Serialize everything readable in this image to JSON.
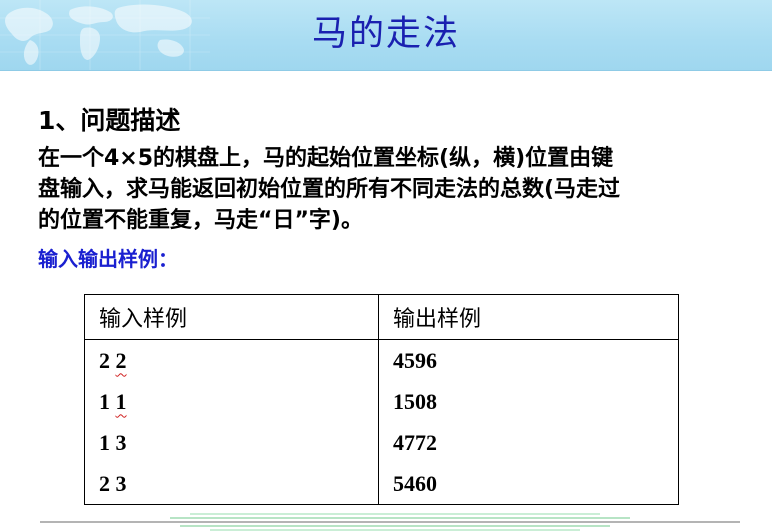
{
  "slide": {
    "title": "马的走法",
    "section_heading": "1、问题描述",
    "description_lines": [
      "在一个4×5的棋盘上，马的起始位置坐标(纵，横)位置由键",
      "盘输入，求马能返回初始位置的所有不同走法的总数(马走过",
      "的位置不能重复，马走“日”字)。"
    ],
    "sample_heading": "输入输出样例："
  },
  "table": {
    "headers": [
      "输入样例",
      "输出样例"
    ],
    "rows": [
      {
        "input_a": "2",
        "input_b": "2",
        "output": "4596"
      },
      {
        "input_a": "1",
        "input_b": "1",
        "output": "1508"
      },
      {
        "input_a": "1",
        "input_b": "3",
        "output": "4772"
      },
      {
        "input_a": "2",
        "input_b": "3",
        "output": "5460"
      }
    ]
  },
  "colors": {
    "title": "#1a20b0",
    "sample_heading": "#1a20d0",
    "header_band": "#a8dcf2",
    "spellcheck_underline": "#d02020"
  },
  "icons": {
    "header_decoration": "world-map-graphic",
    "footer_decoration": "horizontal-lines-graphic"
  }
}
